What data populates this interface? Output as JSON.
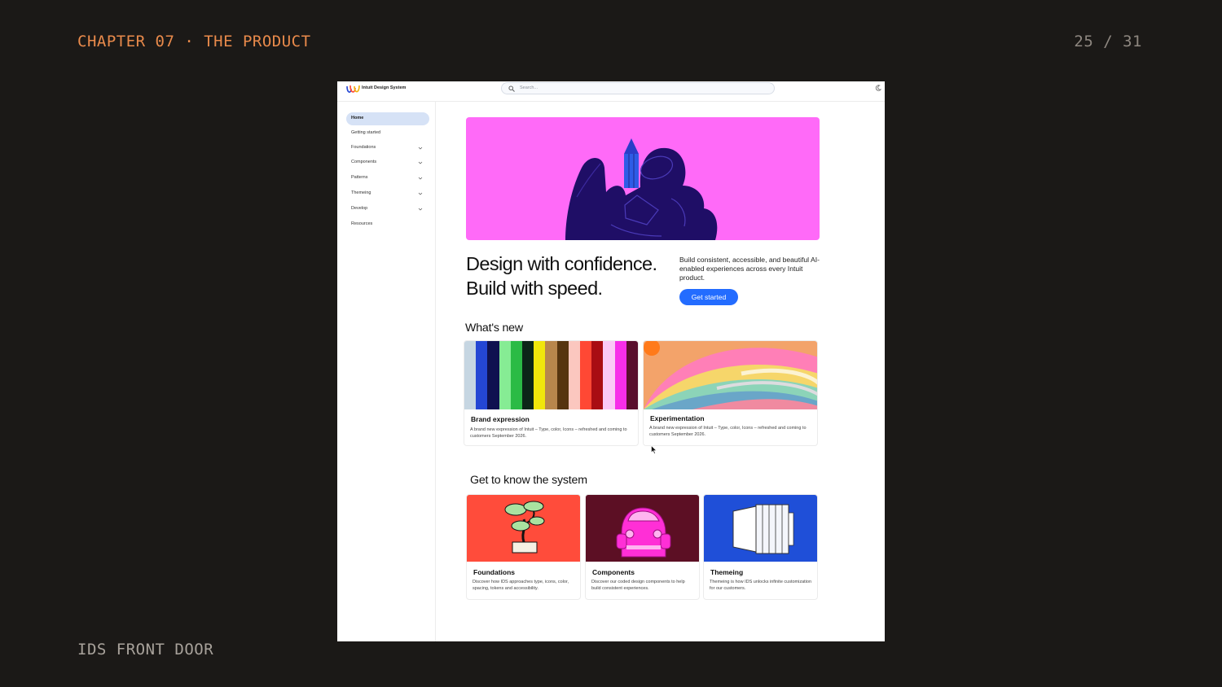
{
  "slide": {
    "chapter": "CHAPTER 07 · THE PRODUCT",
    "page": "25 / 31",
    "footer": "IDS FRONT DOOR"
  },
  "topbar": {
    "logo_text": "Intuit Design System",
    "search_placeholder": "Search..."
  },
  "sidebar": {
    "items": [
      {
        "label": "Home",
        "active": true,
        "expandable": false
      },
      {
        "label": "Getting started",
        "active": false,
        "expandable": false
      },
      {
        "label": "Foundations",
        "active": false,
        "expandable": true
      },
      {
        "label": "Components",
        "active": false,
        "expandable": true
      },
      {
        "label": "Patterns",
        "active": false,
        "expandable": true
      },
      {
        "label": "Themeing",
        "active": false,
        "expandable": true
      },
      {
        "label": "Develop",
        "active": false,
        "expandable": true
      },
      {
        "label": "Resources",
        "active": false,
        "expandable": false
      }
    ]
  },
  "hero": {
    "headline_1": "Design with confidence.",
    "headline_2": "Build with speed.",
    "intro": "Build consistent, accessible, and beautiful AI-enabled experiences across every Intuit product.",
    "cta": "Get started"
  },
  "whats_new": {
    "title": "What's new",
    "cards": [
      {
        "title": "Brand expression",
        "desc": "A brand new expression of Intuit – Type, color, Icons – refreshed and coming to customers September 2026."
      },
      {
        "title": "Experimentation",
        "desc": "A brand new expression of Intuit – Type, color, Icons – refreshed and coming to customers September 2026."
      }
    ]
  },
  "system": {
    "title": "Get to know the system",
    "cards": [
      {
        "title": "Foundations",
        "desc": "Discover how IDS approaches type, icons, color, spacing, tokens and accessibility."
      },
      {
        "title": "Components",
        "desc": "Discover our coded design components to help build consistent experiences."
      },
      {
        "title": "Themeing",
        "desc": "Themeing is how IDS unlocks infinite customization for our customers."
      }
    ]
  },
  "colors": {
    "accent": "#236cff",
    "hero_bg": "#ff6af8",
    "chapter_text": "#e98a4b",
    "foundations_bg": "#ff4c3b",
    "components_bg": "#5c0f24",
    "themeing_bg": "#1f4fd8"
  },
  "stripe_colors": [
    "#c6d6e2",
    "#2446d4",
    "#0f1150",
    "#86ec94",
    "#2bbb45",
    "#0c2618",
    "#f1e60b",
    "#b8864c",
    "#56340f",
    "#fbc7bf",
    "#ff4834",
    "#a90d13",
    "#fbc9f6",
    "#f72ee9",
    "#5a0f2e"
  ]
}
